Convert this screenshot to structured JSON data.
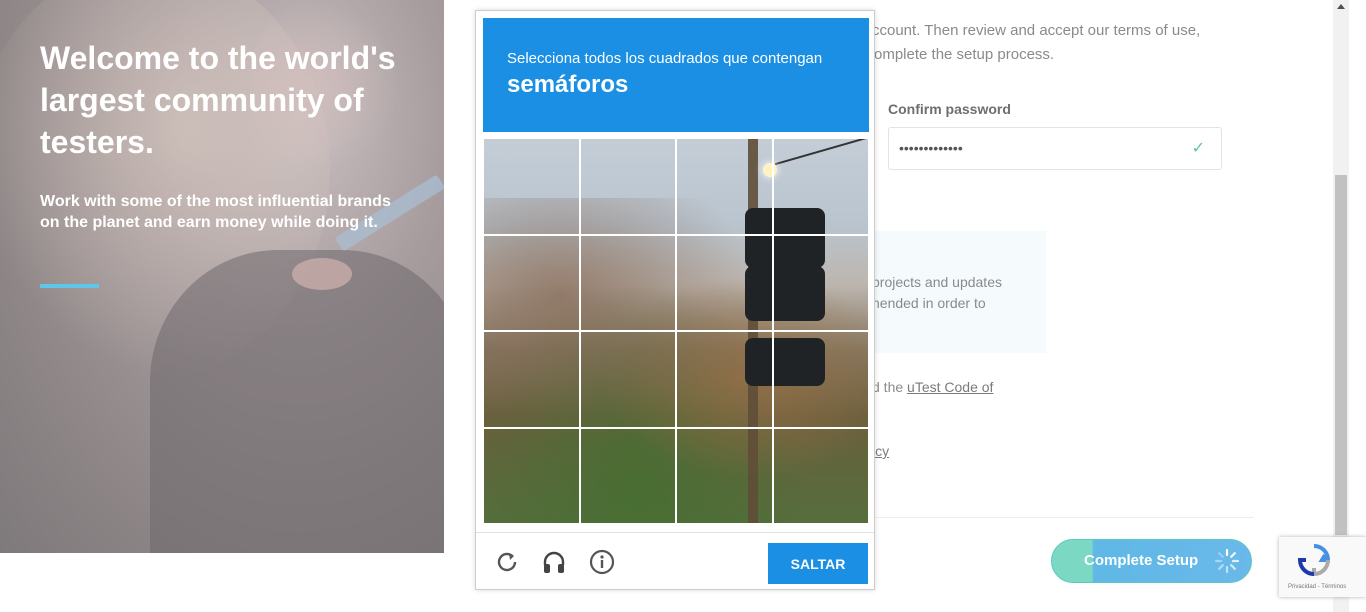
{
  "hero": {
    "title": "Welcome to the world's largest community of testers.",
    "subtitle": "Work with some of the most influential brands on the planet and earn money while doing it.",
    "accent_color": "#5ec6e8"
  },
  "form": {
    "intro_line1": "ccount. Then review and accept our terms of use,",
    "intro_line2": "omplete the setup process.",
    "confirm_password_label": "Confirm password",
    "confirm_password_value": "•••••••••••••",
    "info_line1": "projects and updates",
    "info_line2": "hended in order to",
    "code_prefix": "d the ",
    "code_link": "uTest Code of",
    "policy_fragment": "icy",
    "complete_button": "Complete Setup"
  },
  "captcha": {
    "instruction": "Selecciona todos los cuadrados que contengan",
    "target": "semáforos",
    "skip_button": "SALTAR",
    "reload_icon": "reload-icon",
    "audio_icon": "headphones-icon",
    "info_icon": "info-icon",
    "header_color": "#1a8fe3"
  },
  "recaptcha_badge": {
    "terms": "Privacidad - Términos"
  }
}
